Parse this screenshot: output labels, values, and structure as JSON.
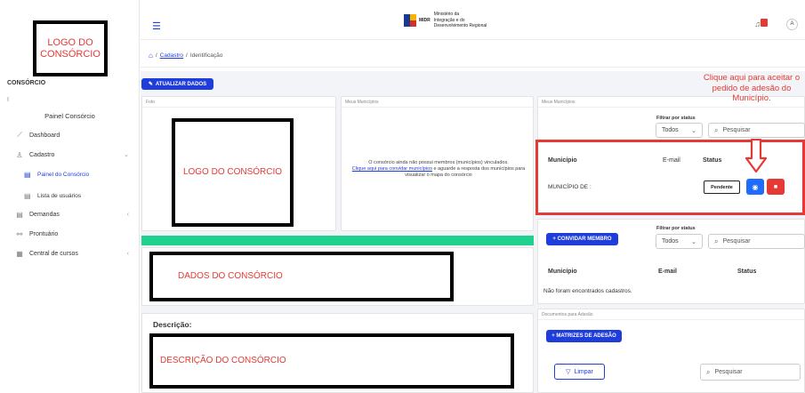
{
  "sidebar": {
    "logo_text": "LOGO DO CONSÓRCIO",
    "title": "CONSÓRCIO",
    "subtitle": "I",
    "panel_label": "Painel Consórcio",
    "items": [
      {
        "label": "Dashboard",
        "icon": "chart-line-icon"
      },
      {
        "label": "Cadastro",
        "icon": "user-icon"
      },
      {
        "label": "Painel do Consórcio",
        "icon": "file-icon"
      },
      {
        "label": "Lista de usuários",
        "icon": "file-icon"
      },
      {
        "label": "Demandas",
        "icon": "file-icon"
      },
      {
        "label": "Prontuário",
        "icon": "network-icon"
      },
      {
        "label": "Central de cursos",
        "icon": "book-icon"
      }
    ]
  },
  "topbar": {
    "org_code": "MIDR",
    "org_line1": "Ministério da",
    "org_line2": "Integração e do",
    "org_line3": "Desenvolvimento Regional",
    "avatar_initial": "A",
    "notification_count": "1"
  },
  "breadcrumb": {
    "separator": "/",
    "link": "Cadastro",
    "current": "Identificação"
  },
  "main": {
    "update_button": "ATUALIZAR DADOS",
    "foto_header": "Foto",
    "logo_annotation": "LOGO DO CONSÓRCIO",
    "membros_header": "Meus Municípios",
    "no_members_text_1": "O consórcio ainda não possui membros (municípios) vinculados.",
    "no_members_link": "Clique aqui para convidar municípios",
    "no_members_text_2": "e aguarde a resposta dos municípios para visualizar o mapa do consórcio",
    "dados_annotation": "DADOS DO CONSÓRCIO",
    "descricao_label": "Descrição:",
    "descricao_annotation": "DESCRIÇÃO DO CONSÓRCIO"
  },
  "municipios_panel": {
    "header": "Meus Municípios",
    "filter_label": "Filtrar por status",
    "filter_value": "Todos",
    "search_placeholder": "Pesquisar",
    "col_municipio": "Município",
    "col_email": "E-mail",
    "col_status": "Status",
    "row_municipio": "MUNICÍPIO DE :",
    "row_status_button": "Pendente",
    "annotation": "Clique aqui para aceitar o pedido de adesão do Município."
  },
  "membros_panel": {
    "invite_button": "+ CONVIDAR MEMBRO",
    "filter_label": "Filtrar por status",
    "filter_value": "Todos",
    "search_placeholder": "Pesquisar",
    "col_municipio": "Município",
    "col_email": "E-mail",
    "col_status": "Status",
    "empty": "Não foram encontrados cadastros."
  },
  "documentos_panel": {
    "header": "Documentos para Adesão",
    "matrizes_button": "+ MATRIZES DE ADESÃO",
    "limpar_button": "Limpar",
    "search_placeholder": "Pesquisar"
  },
  "colors": {
    "primary": "#1f3ddb",
    "green": "#1ed18f",
    "danger": "#e53935"
  }
}
